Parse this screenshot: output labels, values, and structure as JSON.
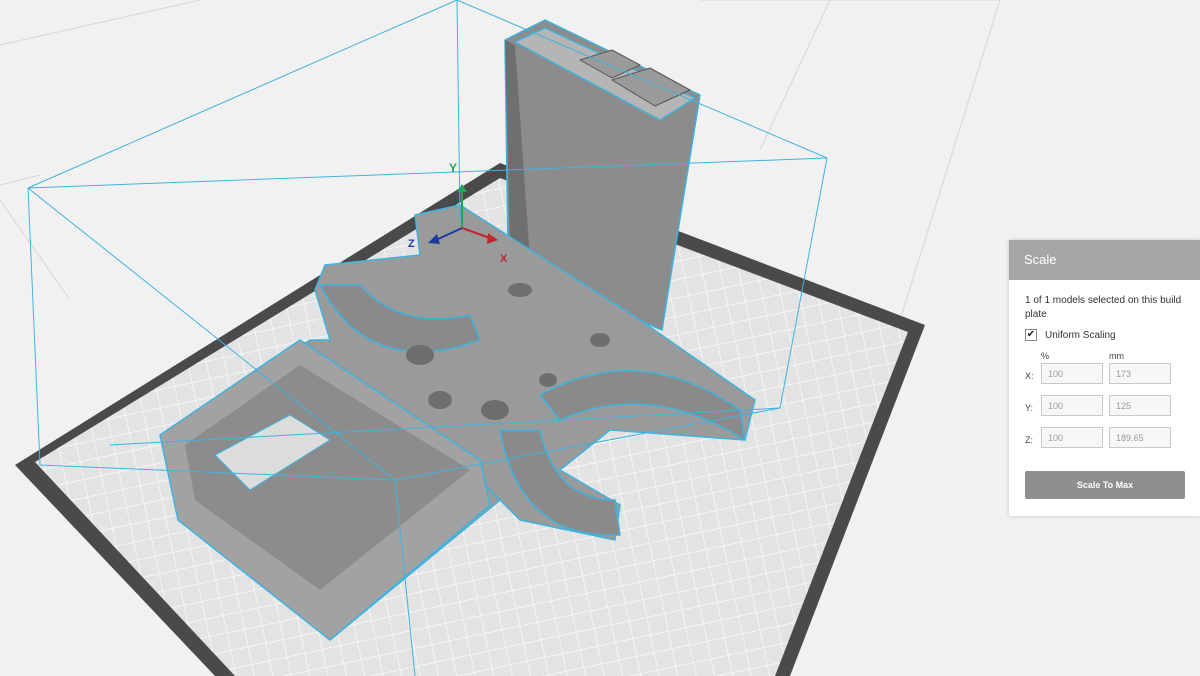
{
  "viewport": {
    "axis_labels": {
      "y": "Y",
      "z": "Z",
      "x": "X"
    },
    "colors": {
      "background": "#f1f1f1",
      "plate": "#e0e0e0",
      "plate_border": "#4a4a4a",
      "model": "#8e8e8e",
      "selection_outline": "#3fb3df",
      "axis_x": "#c0262d",
      "axis_y": "#22a55a",
      "axis_z": "#1f3a9e"
    }
  },
  "scale_panel": {
    "title": "Scale",
    "selection_info": "1 of 1 models selected on this build plate",
    "uniform_scaling": {
      "label": "Uniform Scaling",
      "checked": true,
      "check_glyph": "✔"
    },
    "column_percent": "%",
    "column_mm": "mm",
    "rows": [
      {
        "axis": "X:",
        "percent": "100",
        "mm": "173"
      },
      {
        "axis": "Y:",
        "percent": "100",
        "mm": "125"
      },
      {
        "axis": "Z:",
        "percent": "100",
        "mm": "189.65"
      }
    ],
    "scale_to_max_label": "Scale To Max"
  }
}
